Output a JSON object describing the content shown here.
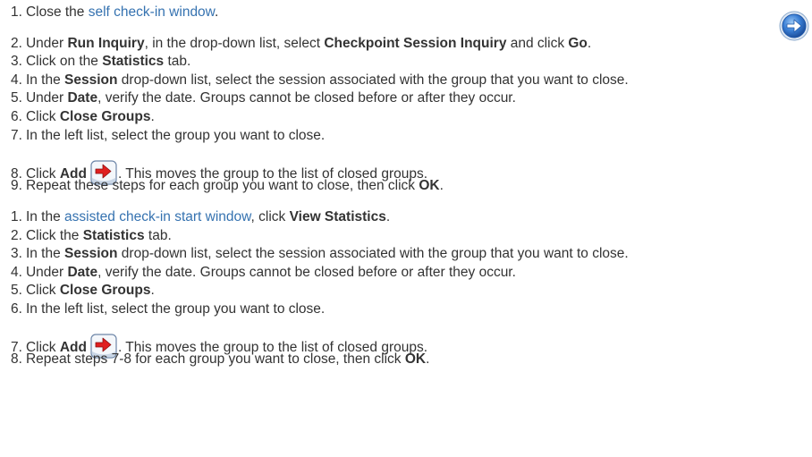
{
  "section1": {
    "steps": [
      {
        "num": "1.",
        "before": "Close the ",
        "link": "self check-in window",
        "after": "."
      },
      {
        "num": "2.",
        "t1": "Under ",
        "b1": "Run Inquiry",
        "t2": ", in the drop-down list, select ",
        "b2": "Checkpoint Session Inquiry",
        "t3": " and click ",
        "b3": "Go",
        "t4": "."
      },
      {
        "num": "3.",
        "t1": "Click on the ",
        "b1": "Statistics",
        "t2": " tab."
      },
      {
        "num": "4.",
        "t1": "In the ",
        "b1": "Session",
        "t2": " drop-down list, select the session associated with the group that you want to close."
      },
      {
        "num": "5.",
        "t1": "Under ",
        "b1": "Date",
        "t2": ", verify the date. Groups cannot be closed before or after they occur."
      },
      {
        "num": "6.",
        "t1": "Click ",
        "b1": "Close Groups",
        "t2": "."
      },
      {
        "num": "7.",
        "t1": "In the left list, select the group you want to close."
      },
      {
        "num": "8.",
        "t1": "Click ",
        "b1": "Add",
        "t2": ". This moves the group to the list of closed groups."
      },
      {
        "num": "9.",
        "t1": "Repeat these steps for each group you want to close, then click ",
        "b1": "OK",
        "t2": "."
      }
    ]
  },
  "section2": {
    "steps": [
      {
        "num": "1.",
        "t1": "In the ",
        "link": "assisted check-in start window",
        "t2": ", click ",
        "b1": "View Statistics",
        "t3": "."
      },
      {
        "num": "2.",
        "t1": "Click the ",
        "b1": "Statistics",
        "t2": " tab."
      },
      {
        "num": "3.",
        "t1": "In the ",
        "b1": "Session",
        "t2": " drop-down list, select the session associated with the group that you want to close."
      },
      {
        "num": "4.",
        "t1": "Under ",
        "b1": "Date",
        "t2": ", verify the date. Groups cannot be closed before or after they occur."
      },
      {
        "num": "5.",
        "t1": "Click ",
        "b1": "Close Groups",
        "t2": "."
      },
      {
        "num": "6.",
        "t1": "In the left list, select the group you want to close."
      },
      {
        "num": "7.",
        "t1": "Click ",
        "b1": "Add",
        "t2": ". This moves the group to the list of closed groups."
      },
      {
        "num": "8.",
        "t1": "Repeat steps 7-8 for each group you want to close, then click ",
        "b1": "OK",
        "t2": "."
      }
    ]
  },
  "icons": {
    "go": "go-arrow-icon",
    "add": "add-arrow-icon"
  },
  "colors": {
    "link": "#3572b0",
    "text": "#333333",
    "go_button": "#3a7fd5",
    "add_arrow": "#e02020"
  }
}
